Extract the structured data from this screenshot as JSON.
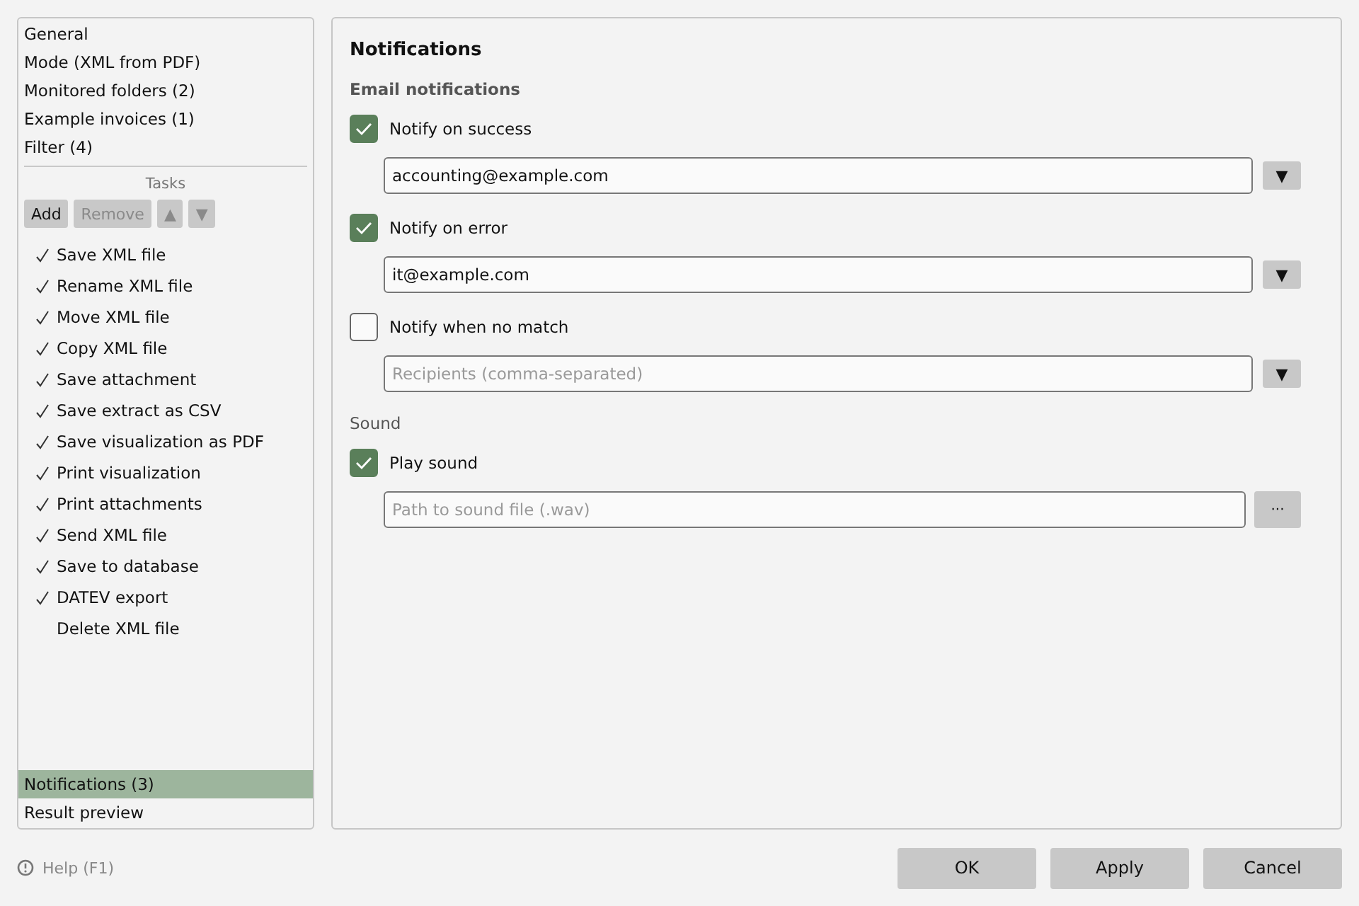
{
  "sidebar": {
    "top_items": [
      {
        "label": "General",
        "selected": false
      },
      {
        "label": "Mode (XML from PDF)",
        "selected": false
      },
      {
        "label": "Monitored folders (2)",
        "selected": false
      },
      {
        "label": "Example invoices (1)",
        "selected": false
      },
      {
        "label": "Filter (4)",
        "selected": false
      }
    ],
    "tasks_label": "Tasks",
    "task_buttons": [
      {
        "label": "Add",
        "disabled": false
      },
      {
        "label": "Remove",
        "disabled": true
      },
      {
        "label": "▲",
        "disabled": true
      },
      {
        "label": "▼",
        "disabled": true
      }
    ],
    "tasks": [
      {
        "label": "Save XML file",
        "checked": true
      },
      {
        "label": "Rename XML file",
        "checked": true
      },
      {
        "label": "Move XML file",
        "checked": true
      },
      {
        "label": "Copy XML file",
        "checked": true
      },
      {
        "label": "Save attachment",
        "checked": true
      },
      {
        "label": "Save extract as CSV",
        "checked": true
      },
      {
        "label": "Save visualization as PDF",
        "checked": true
      },
      {
        "label": "Print visualization",
        "checked": true
      },
      {
        "label": "Print attachments",
        "checked": true
      },
      {
        "label": "Send XML file",
        "checked": true
      },
      {
        "label": "Save to database",
        "checked": true
      },
      {
        "label": "DATEV export",
        "checked": true
      },
      {
        "label": "Delete XML file",
        "checked": false
      }
    ],
    "bottom_items": [
      {
        "label": "Notifications (3)",
        "selected": true
      },
      {
        "label": "Result preview",
        "selected": false
      }
    ]
  },
  "panel": {
    "title": "Notifications",
    "sections": [
      {
        "heading": "Email notifications",
        "options": [
          {
            "label": "Notify on success",
            "checked": true,
            "field": {
              "value": "accounting@example.com"
            },
            "button": "▼"
          },
          {
            "label": "Notify on error",
            "checked": true,
            "field": {
              "value": "it@example.com"
            },
            "button": "▼"
          },
          {
            "label": "Notify when no match",
            "checked": false,
            "field": {
              "placeholder": "Recipients (comma-separated)"
            },
            "button": "▼"
          }
        ]
      },
      {
        "heading": "Sound",
        "options": [
          {
            "label": "Play sound",
            "checked": true,
            "field": {
              "placeholder": "Path to sound file (.wav)"
            },
            "button": "···"
          }
        ]
      }
    ]
  },
  "footer": {
    "help": "Help (F1)",
    "buttons": [
      "OK",
      "Apply",
      "Cancel"
    ]
  }
}
